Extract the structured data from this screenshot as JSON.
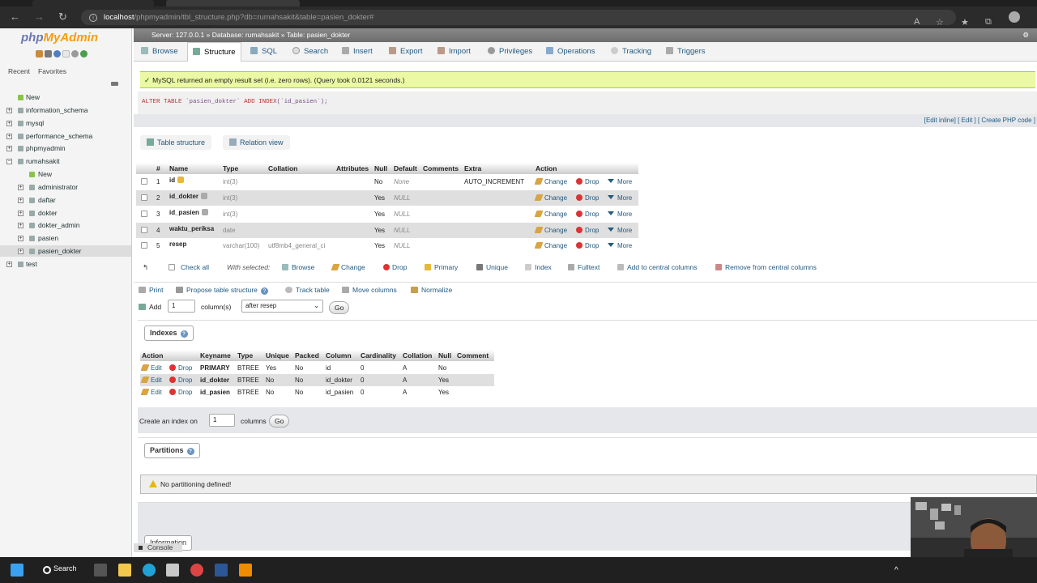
{
  "browser": {
    "url_host": "localhost",
    "url_path": "/phpmyadmin/tbl_structure.php?db=rumahsakit&table=pasien_dokter#"
  },
  "sidebar": {
    "logo_php": "php",
    "logo_myadmin": "MyAdmin",
    "tab_recent": "Recent",
    "tab_favorites": "Favorites",
    "tree": [
      {
        "label": "New"
      },
      {
        "label": "information_schema"
      },
      {
        "label": "mysql"
      },
      {
        "label": "performance_schema"
      },
      {
        "label": "phpmyadmin"
      },
      {
        "label": "rumahsakit"
      },
      {
        "label": "New"
      },
      {
        "label": "administrator"
      },
      {
        "label": "daftar"
      },
      {
        "label": "dokter"
      },
      {
        "label": "dokter_admin"
      },
      {
        "label": "pasien"
      },
      {
        "label": "pasien_dokter"
      },
      {
        "label": "test"
      }
    ]
  },
  "breadcrumb": {
    "server": "Server: 127.0.0.1",
    "database": "Database: rumahsakit",
    "table": "Table: pasien_dokter",
    "sep": "»"
  },
  "menu": {
    "items": [
      {
        "label": "Browse"
      },
      {
        "label": "Structure"
      },
      {
        "label": "SQL"
      },
      {
        "label": "Search"
      },
      {
        "label": "Insert"
      },
      {
        "label": "Export"
      },
      {
        "label": "Import"
      },
      {
        "label": "Privileges"
      },
      {
        "label": "Operations"
      },
      {
        "label": "Tracking"
      },
      {
        "label": "Triggers"
      }
    ]
  },
  "message": {
    "success": "MySQL returned an empty result set (i.e. zero rows). (Query took 0.0121 seconds.)"
  },
  "sql": {
    "kw1": "ALTER TABLE",
    "table": "`pasien_dokter`",
    "kw2": "ADD INDEX",
    "col": "(`id_pasien`);"
  },
  "edit_links": "[Edit inline] [ Edit ] [ Create PHP code ]",
  "subtabs": {
    "structure": "Table structure",
    "relation": "Relation view"
  },
  "structure": {
    "headers": {
      "num": "#",
      "name": "Name",
      "type": "Type",
      "collation": "Collation",
      "attributes": "Attributes",
      "null": "Null",
      "default": "Default",
      "comments": "Comments",
      "extra": "Extra",
      "action": "Action"
    },
    "rows": [
      {
        "num": "1",
        "name": "id",
        "type": "int(3)",
        "collation": "",
        "null": "No",
        "default": "None",
        "extra": "AUTO_INCREMENT"
      },
      {
        "num": "2",
        "name": "id_dokter",
        "type": "int(3)",
        "collation": "",
        "null": "Yes",
        "default": "NULL",
        "extra": ""
      },
      {
        "num": "3",
        "name": "id_pasien",
        "type": "int(3)",
        "collation": "",
        "null": "Yes",
        "default": "NULL",
        "extra": ""
      },
      {
        "num": "4",
        "name": "waktu_periksa",
        "type": "date",
        "collation": "",
        "null": "Yes",
        "default": "NULL",
        "extra": ""
      },
      {
        "num": "5",
        "name": "resep",
        "type": "varchar(100)",
        "collation": "utf8mb4_general_ci",
        "null": "Yes",
        "default": "NULL",
        "extra": ""
      }
    ],
    "actions": {
      "change": "Change",
      "drop": "Drop",
      "more": "More"
    }
  },
  "with_selected": {
    "check_all": "Check all",
    "with_selected": "With selected:",
    "browse": "Browse",
    "change": "Change",
    "drop": "Drop",
    "primary": "Primary",
    "unique": "Unique",
    "index": "Index",
    "fulltext": "Fulltext",
    "add_central": "Add to central columns",
    "remove_central": "Remove from central columns"
  },
  "options": {
    "print": "Print",
    "propose": "Propose table structure",
    "track": "Track table",
    "move": "Move columns",
    "normalize": "Normalize",
    "add": "Add",
    "add_value": "1",
    "columns_label": "column(s)",
    "after_select": "after resep",
    "go": "Go"
  },
  "indexes": {
    "legend": "Indexes",
    "headers": {
      "action": "Action",
      "keyname": "Keyname",
      "type": "Type",
      "unique": "Unique",
      "packed": "Packed",
      "column": "Column",
      "cardinality": "Cardinality",
      "collation": "Collation",
      "null": "Null",
      "comment": "Comment"
    },
    "edit": "Edit",
    "drop": "Drop",
    "rows": [
      {
        "keyname": "PRIMARY",
        "type": "BTREE",
        "unique": "Yes",
        "packed": "No",
        "column": "id",
        "cardinality": "0",
        "collation": "A",
        "null": "No"
      },
      {
        "keyname": "id_dokter",
        "type": "BTREE",
        "unique": "No",
        "packed": "No",
        "column": "id_dokter",
        "cardinality": "0",
        "collation": "A",
        "null": "Yes"
      },
      {
        "keyname": "id_pasien",
        "type": "BTREE",
        "unique": "No",
        "packed": "No",
        "column": "id_pasien",
        "cardinality": "0",
        "collation": "A",
        "null": "Yes"
      }
    ]
  },
  "create_index": {
    "label": "Create an index on",
    "value": "1",
    "suffix": "columns",
    "go": "Go"
  },
  "partitions": {
    "legend": "Partitions",
    "notice": "No partitioning defined!"
  },
  "information": {
    "legend": "Information"
  },
  "console": {
    "label": "Console"
  },
  "taskbar": {
    "search": "Search"
  }
}
